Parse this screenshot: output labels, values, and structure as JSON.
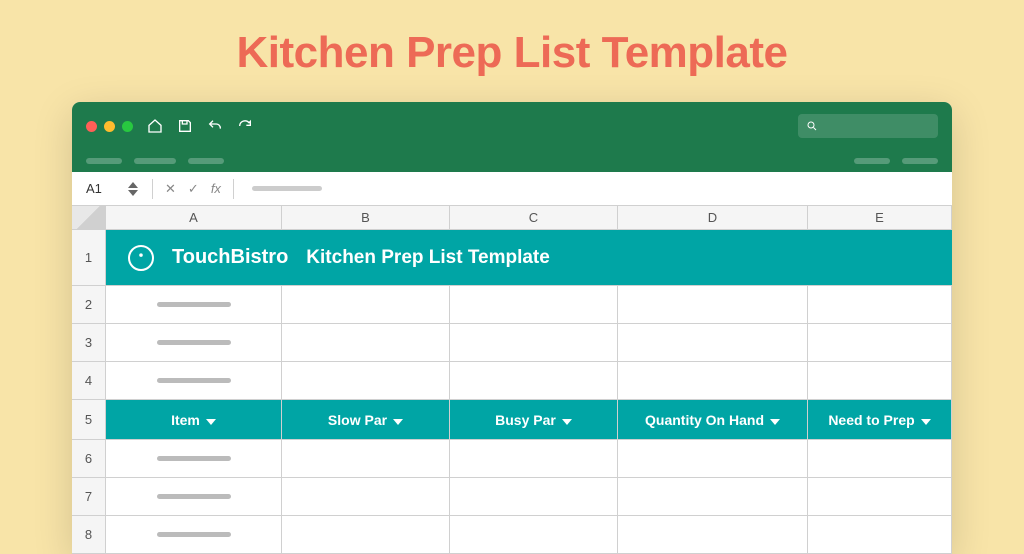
{
  "page": {
    "heading": "Kitchen Prep List Template"
  },
  "window": {
    "search_placeholder": "",
    "cell_ref": "A1",
    "fx_label": "fx"
  },
  "columns": [
    "A",
    "B",
    "C",
    "D",
    "E"
  ],
  "rows": [
    "1",
    "2",
    "3",
    "4",
    "5",
    "6",
    "7",
    "8"
  ],
  "banner": {
    "brand": "TouchBistro",
    "title": "Kitchen Prep List Template"
  },
  "table_headers": {
    "item": "Item",
    "slow_par": "Slow Par",
    "busy_par": "Busy Par",
    "qty_on_hand": "Quantity On Hand",
    "need_to_prep": "Need to Prep"
  },
  "colors": {
    "accent": "#00a5a5",
    "titlebar": "#1e7a4c",
    "heading": "#ed6a56"
  }
}
